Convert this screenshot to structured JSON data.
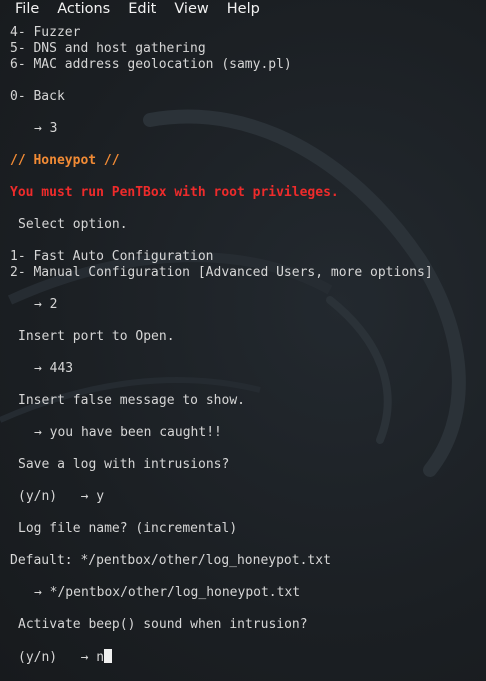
{
  "menu": [
    "File",
    "Actions",
    "Edit",
    "View",
    "Help"
  ],
  "lines": {
    "l1": "4- Fuzzer",
    "l2": "5- DNS and host gathering",
    "l3": "6- MAC address geolocation (samy.pl)",
    "l4": "0- Back",
    "prompt1": {
      "arrow": "→",
      "value": "3"
    },
    "section": "// Honeypot //",
    "warning": "You must run PenTBox with root privileges.",
    "select": "Select option.",
    "opt1": "1- Fast Auto Configuration",
    "opt2": "2- Manual Configuration [Advanced Users, more options]",
    "prompt2": {
      "arrow": "→",
      "value": "2"
    },
    "port_q": "Insert port to Open.",
    "prompt3": {
      "arrow": "→",
      "value": "443"
    },
    "msg_q": "Insert false message to show.",
    "prompt4": {
      "arrow": "→",
      "value": "you have been caught!!"
    },
    "log_q": "Save a log with intrusions?",
    "prompt5": {
      "prefix": "(y/n)",
      "arrow": "→",
      "value": "y"
    },
    "logname_q": "Log file name? (incremental)",
    "default_line": "Default: */pentbox/other/log_honeypot.txt",
    "prompt6": {
      "arrow": "→",
      "value": "*/pentbox/other/log_honeypot.txt"
    },
    "beep_q": "Activate beep() sound when intrusion?",
    "prompt7": {
      "prefix": "(y/n)",
      "arrow": "→",
      "value": "n"
    }
  },
  "colors": {
    "background": "#1d2125",
    "text": "#d6d6d6",
    "section": "#f28b35",
    "warning": "#ee2b2b"
  }
}
